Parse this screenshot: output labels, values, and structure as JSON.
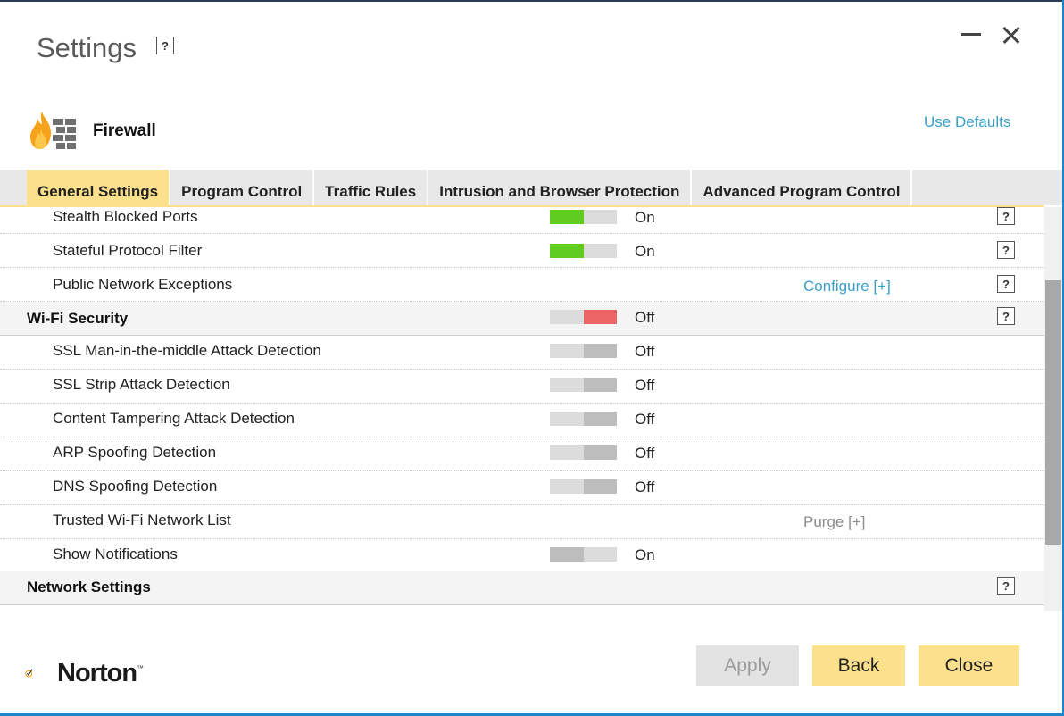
{
  "window": {
    "title": "Settings"
  },
  "header": {
    "section_title": "Firewall",
    "use_defaults": "Use Defaults"
  },
  "tabs": [
    {
      "label": "General Settings",
      "active": true
    },
    {
      "label": "Program Control",
      "active": false
    },
    {
      "label": "Traffic Rules",
      "active": false
    },
    {
      "label": "Intrusion and Browser Protection",
      "active": false
    },
    {
      "label": "Advanced Program Control",
      "active": false
    }
  ],
  "rows": {
    "stealth": {
      "label": "Stealth Blocked Ports",
      "state": "On"
    },
    "stateful": {
      "label": "Stateful Protocol Filter",
      "state": "On"
    },
    "public": {
      "label": "Public Network Exceptions",
      "action": "Configure [+]"
    },
    "wifi": {
      "label": "Wi-Fi Security",
      "state": "Off"
    },
    "ssl_mitm": {
      "label": "SSL Man-in-the-middle Attack Detection",
      "state": "Off"
    },
    "ssl_strip": {
      "label": "SSL Strip Attack Detection",
      "state": "Off"
    },
    "content_tamper": {
      "label": "Content Tampering Attack Detection",
      "state": "Off"
    },
    "arp": {
      "label": "ARP Spoofing Detection",
      "state": "Off"
    },
    "dns": {
      "label": "DNS Spoofing Detection",
      "state": "Off"
    },
    "trusted_wifi": {
      "label": "Trusted Wi-Fi Network List",
      "action": "Purge [+]"
    },
    "notifications": {
      "label": "Show Notifications",
      "state": "On"
    },
    "network": {
      "label": "Network Settings"
    }
  },
  "footer": {
    "brand": "Norton",
    "trademark": "™",
    "apply": "Apply",
    "back": "Back",
    "close": "Close"
  },
  "colors": {
    "toggle_on_green": "#5fcc1f",
    "toggle_off_red": "#ec6464",
    "toggle_light": "#dcdcdc",
    "toggle_dark": "#bdbdbd",
    "accent_yellow": "#fde08b",
    "link_blue": "#3aa0c8"
  },
  "icons": {
    "help": "question-mark-box",
    "firewall": "flame-brick-wall",
    "minimize": "minimize-dash",
    "close": "close-x"
  },
  "help_glyph": "?"
}
